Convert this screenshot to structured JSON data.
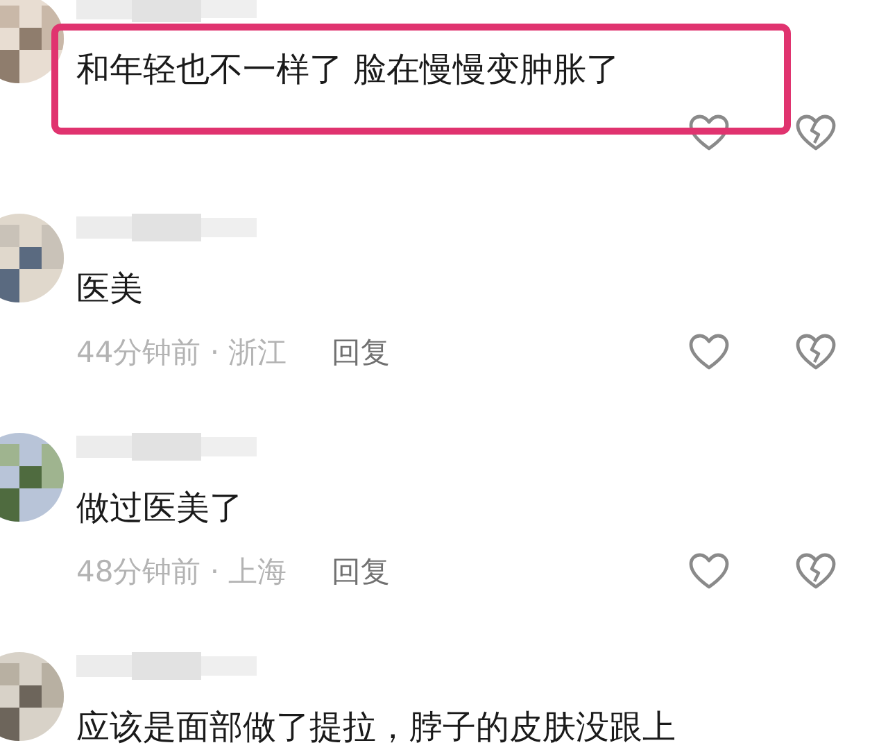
{
  "comments": [
    {
      "text": "和年轻也不一样了 脸在慢慢变肿胀了",
      "actions": true,
      "highlighted": true
    },
    {
      "text": "医美",
      "time_location": "44分钟前 · 浙江",
      "reply": "回复",
      "actions": true,
      "highlighted": false
    },
    {
      "text": "做过医美了",
      "time_location": "48分钟前 · 上海",
      "reply": "回复",
      "actions": true,
      "highlighted": false
    },
    {
      "text": "应该是面部做了提拉，脖子的皮肤没跟上",
      "actions": false,
      "highlighted": false
    }
  ]
}
